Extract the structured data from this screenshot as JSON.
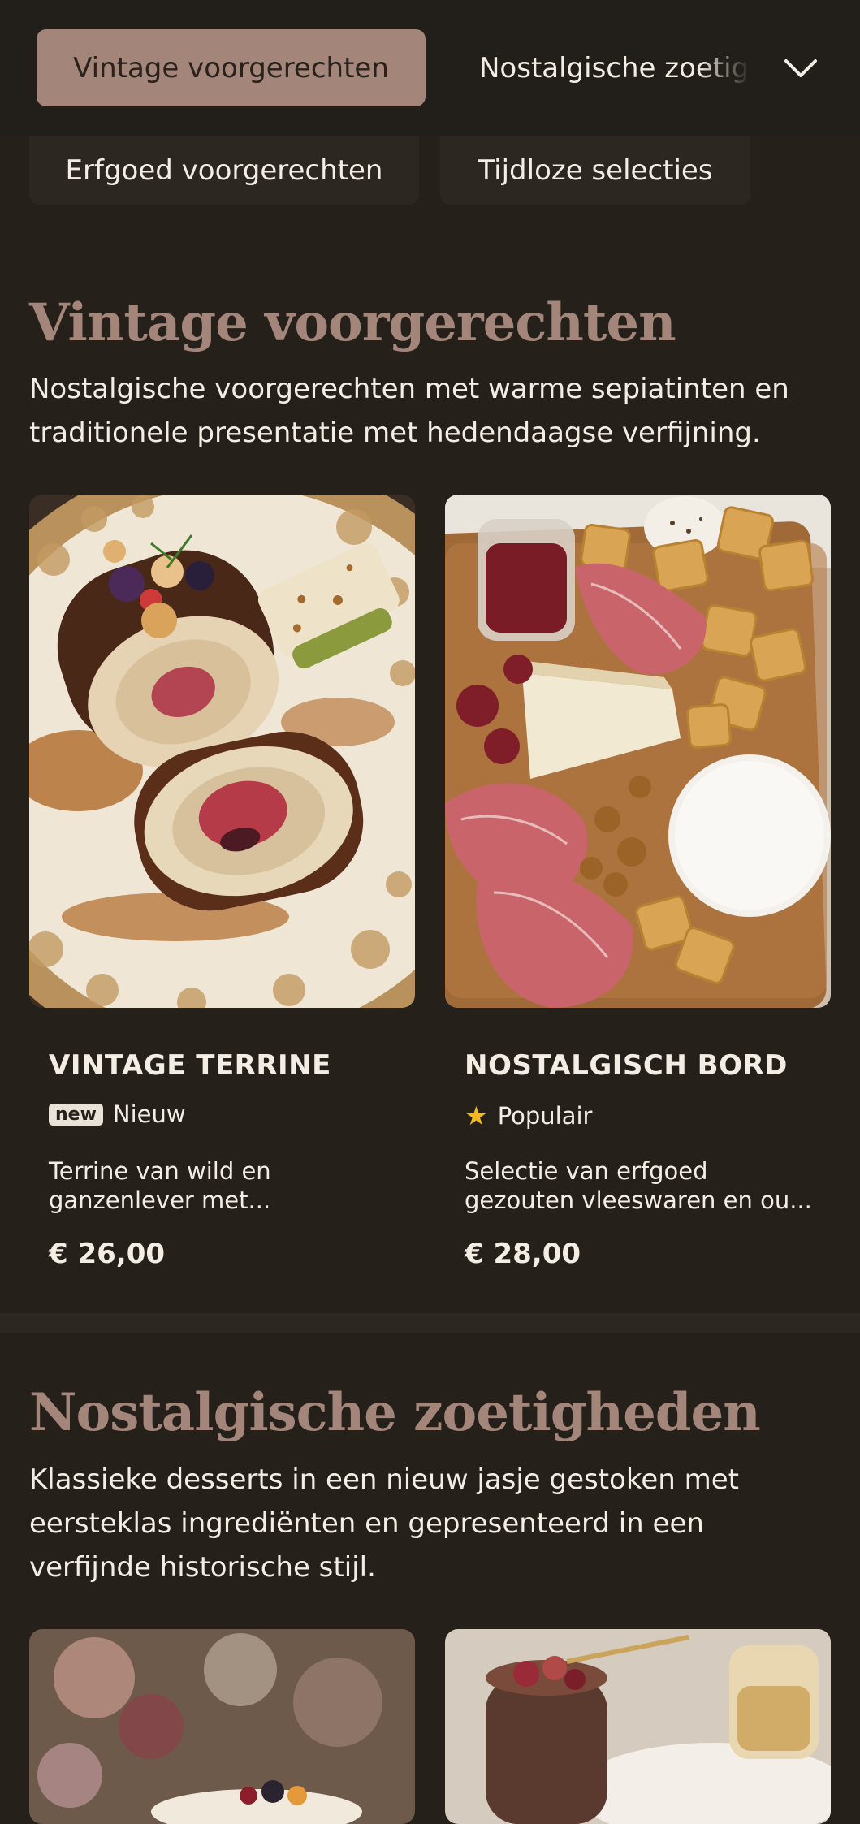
{
  "nav": {
    "active_tab": "Vintage voorgerechten",
    "next_tab": "Nostalgische zoetigheden",
    "chevron_icon": "chevron-down-icon",
    "sub_items": [
      "Erfgoed voorgerechten",
      "Tijdloze selecties"
    ]
  },
  "sections": [
    {
      "title": "Vintage voorgerechten",
      "description": "Nostalgische voorgerechten met warme sepiatinten en traditionele presentatie met hedendaagse verfijning.",
      "cards": [
        {
          "title": "VINTAGE TERRINE",
          "badge_label": "new",
          "badge_text": "Nieuw",
          "description_line1": "Terrine van wild en",
          "description_line2": "ganzenlever met...",
          "price": "€ 26,00"
        },
        {
          "title": "NOSTALGISCH BORD",
          "badge_icon": "star-icon",
          "badge_text": "Populair",
          "description_line1": "Selectie van erfgoed",
          "description_line2": "gezouten vleeswaren en ou...",
          "price": "€ 28,00"
        }
      ]
    },
    {
      "title": "Nostalgische zoetigheden",
      "description": "Klassieke desserts in een nieuw jasje gestoken met eersteklas ingrediënten en gepresenteerd in een verfijnde historische stijl."
    }
  ],
  "colors": {
    "background": "#25201a",
    "accent": "#a3857a",
    "text": "#f3ede4",
    "star": "#f2b821"
  }
}
